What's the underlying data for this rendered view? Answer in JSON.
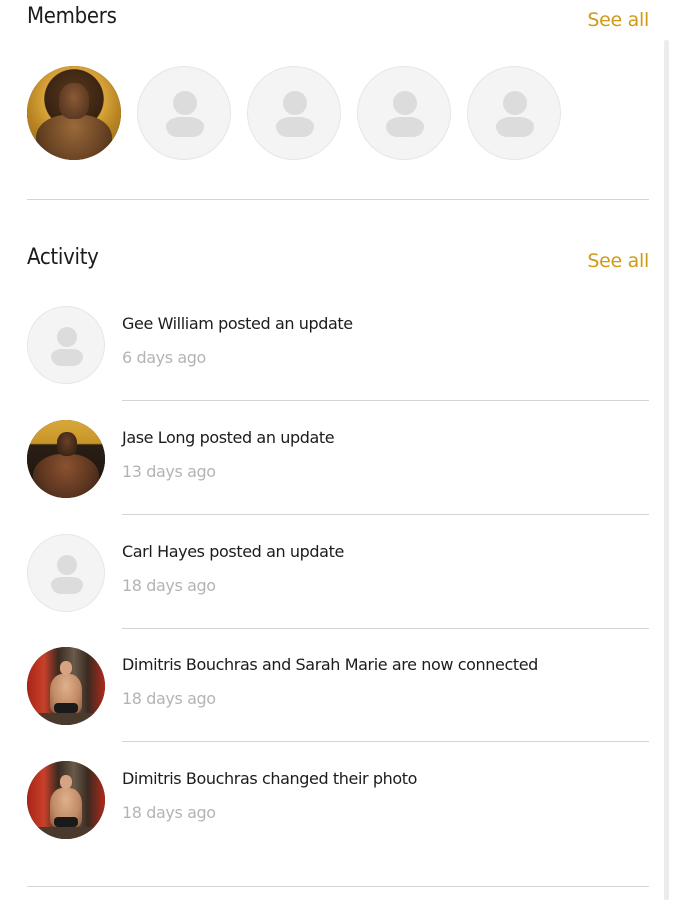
{
  "members": {
    "title": "Members",
    "see_all": "See all",
    "avatars": [
      {
        "type": "photo",
        "style": "gold",
        "icon": "member-photo"
      },
      {
        "type": "placeholder",
        "icon": "default-user-icon"
      },
      {
        "type": "placeholder",
        "icon": "default-user-icon"
      },
      {
        "type": "placeholder",
        "icon": "default-user-icon"
      },
      {
        "type": "placeholder",
        "icon": "default-user-icon"
      }
    ]
  },
  "activity": {
    "title": "Activity",
    "see_all": "See all",
    "items": [
      {
        "text": "Gee William posted an update",
        "time": "6 days ago",
        "avatar": "placeholder"
      },
      {
        "text": "Jase Long posted an update",
        "time": "13 days ago",
        "avatar": "black"
      },
      {
        "text": "Carl Hayes posted an update",
        "time": "18 days ago",
        "avatar": "placeholder"
      },
      {
        "text": "Dimitris Bouchras and Sarah Marie are now connected",
        "time": "18 days ago",
        "avatar": "red"
      },
      {
        "text": "Dimitris Bouchras changed their photo",
        "time": "18 days ago",
        "avatar": "red"
      }
    ]
  },
  "colors": {
    "accent": "#d09a16",
    "text": "#1c1c1c",
    "muted": "#b4b4b4",
    "divider": "#d4d4d4"
  }
}
